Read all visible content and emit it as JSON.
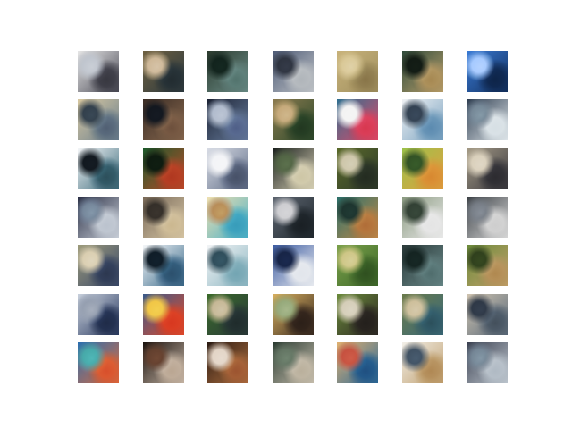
{
  "grid": {
    "rows": 7,
    "cols": 7,
    "tiles": [
      {
        "palette": [
          "#e6e6e6",
          "#4a4a55",
          "#b9bfc9"
        ]
      },
      {
        "palette": [
          "#6e6040",
          "#2d3a40",
          "#c9b08c"
        ]
      },
      {
        "palette": [
          "#2b3a2e",
          "#6d8f8a",
          "#10201a"
        ]
      },
      {
        "palette": [
          "#4d5a75",
          "#c0c4c8",
          "#2a2f3a"
        ]
      },
      {
        "palette": [
          "#c8b27a",
          "#a09060",
          "#d6c38c"
        ]
      },
      {
        "palette": [
          "#2f4a3a",
          "#b8a06d",
          "#101812"
        ]
      },
      {
        "palette": [
          "#3a7bd5",
          "#123060",
          "#9cc4ff"
        ]
      },
      {
        "palette": [
          "#d8c8a0",
          "#6b7f8f",
          "#2e3a45"
        ]
      },
      {
        "palette": [
          "#3a2c24",
          "#8a6a50",
          "#11151c"
        ]
      },
      {
        "palette": [
          "#1b2233",
          "#6a7fa0",
          "#a7b3c7"
        ]
      },
      {
        "palette": [
          "#8b7a4f",
          "#2d4a2b",
          "#c0a070"
        ]
      },
      {
        "palette": [
          "#2f6f8f",
          "#e04a6a",
          "#f2f2f2"
        ]
      },
      {
        "palette": [
          "#f0f2f4",
          "#7aa2c0",
          "#2e3b4a"
        ]
      },
      {
        "palette": [
          "#2d3c4f",
          "#dfe6ea",
          "#6b7c8c"
        ]
      },
      {
        "palette": [
          "#f4f6f8",
          "#3b6a7a",
          "#10161c"
        ]
      },
      {
        "palette": [
          "#1c5a2b",
          "#c04a2a",
          "#0c180e"
        ]
      },
      {
        "palette": [
          "#d8dce5",
          "#5f6c86",
          "#f2f3f6"
        ]
      },
      {
        "palette": [
          "#1a1f1d",
          "#d8d2b8",
          "#4a5b3e"
        ]
      },
      {
        "palette": [
          "#5a6a2a",
          "#2f3a2b",
          "#c8c0a0"
        ]
      },
      {
        "palette": [
          "#9cc24a",
          "#e0a040",
          "#2d4a22"
        ]
      },
      {
        "palette": [
          "#a59b86",
          "#3b3a40",
          "#d6cbb4"
        ]
      },
      {
        "palette": [
          "#2a2f45",
          "#c9cfd8",
          "#6a7a8f"
        ]
      },
      {
        "palette": [
          "#7a6a58",
          "#d6c6a6",
          "#2f2a25"
        ]
      },
      {
        "palette": [
          "#f0e0b0",
          "#4ab0c8",
          "#b08050"
        ]
      },
      {
        "palette": [
          "#5d6570",
          "#222a30",
          "#c8c8cc"
        ]
      },
      {
        "palette": [
          "#2a6f6a",
          "#c08a4a",
          "#1a2f2a"
        ]
      },
      {
        "palette": [
          "#8a9a80",
          "#eaeaea",
          "#2d3a2f"
        ]
      },
      {
        "palette": [
          "#3a3f44",
          "#d8d8d8",
          "#6c727a"
        ]
      },
      {
        "palette": [
          "#9c9a7a",
          "#3b4a6a",
          "#d6c9a8"
        ]
      },
      {
        "palette": [
          "#f4f6f8",
          "#3a6a8a",
          "#0e1a24"
        ]
      },
      {
        "palette": [
          "#f2f4f6",
          "#8fb7c2",
          "#2b4652"
        ]
      },
      {
        "palette": [
          "#3b5aa0",
          "#e8ebf0",
          "#152140"
        ]
      },
      {
        "palette": [
          "#7aa04a",
          "#3f6a2a",
          "#c9c07a"
        ]
      },
      {
        "palette": [
          "#2b3a3a",
          "#6a8a8a",
          "#12201e"
        ]
      },
      {
        "palette": [
          "#6a8a3a",
          "#c0a06a",
          "#2b3a1a"
        ]
      },
      {
        "palette": [
          "#c8d0dc",
          "#2a3a60",
          "#8a95a8"
        ]
      },
      {
        "palette": [
          "#3a5a8a",
          "#e04a2a",
          "#f0c040"
        ]
      },
      {
        "palette": [
          "#3a6a2a",
          "#2a3a3a",
          "#c0b08a"
        ]
      },
      {
        "palette": [
          "#d8b060",
          "#3a2a20",
          "#8aa070"
        ]
      },
      {
        "palette": [
          "#6a8a3a",
          "#2f2a25",
          "#d0c8b0"
        ]
      },
      {
        "palette": [
          "#6a7a4a",
          "#3a6a7a",
          "#c8b890"
        ]
      },
      {
        "palette": [
          "#d0c4b0",
          "#5a6a7a",
          "#2a3340"
        ]
      },
      {
        "palette": [
          "#2a6fb0",
          "#e06a3a",
          "#40a0a0"
        ]
      },
      {
        "palette": [
          "#1a120e",
          "#c8b8a8",
          "#5a3a2a"
        ]
      },
      {
        "palette": [
          "#2a1a12",
          "#b07040",
          "#e0d0c0"
        ]
      },
      {
        "palette": [
          "#2a3a30",
          "#c8c0b0",
          "#5a6a5a"
        ]
      },
      {
        "palette": [
          "#e0b070",
          "#2a6a9a",
          "#c04a3a"
        ]
      },
      {
        "palette": [
          "#f2efe8",
          "#c0a070",
          "#3a4a5a"
        ]
      },
      {
        "palette": [
          "#3a4050",
          "#c0c8d0",
          "#6a7a8a"
        ]
      }
    ]
  }
}
